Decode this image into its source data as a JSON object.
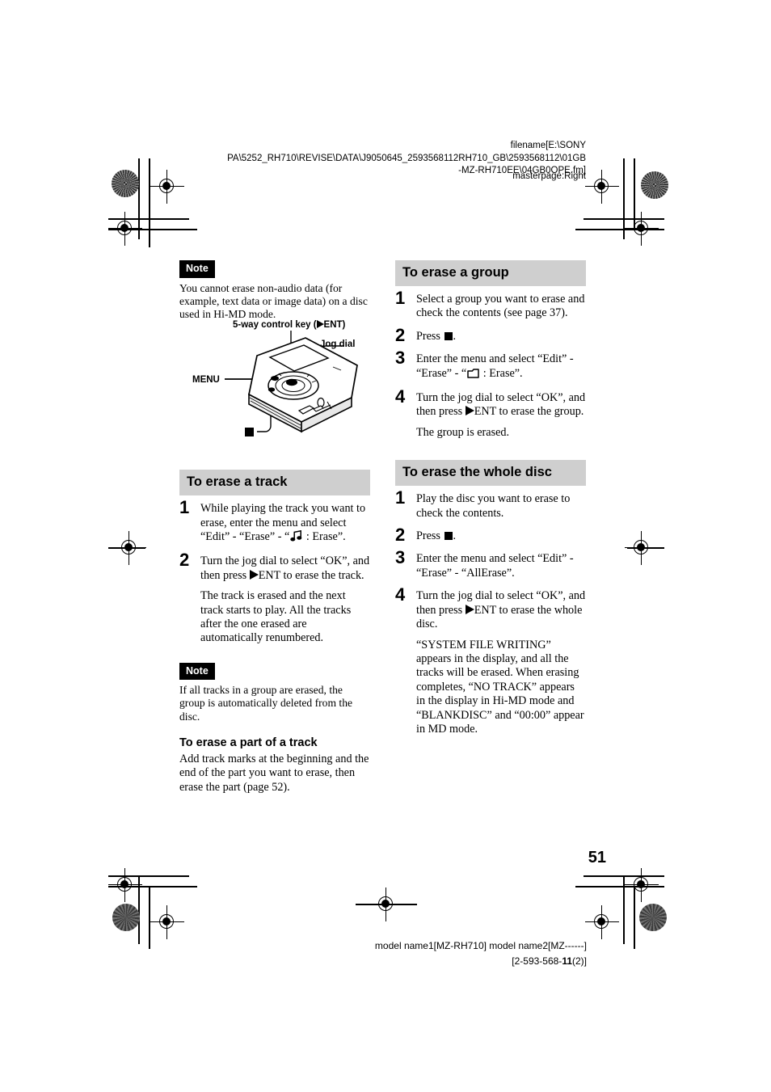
{
  "prepress": {
    "filename_line1": "filename[E:\\SONY",
    "filename_line2": "PA\\5252_RH710\\REVISE\\DATA\\J9050645_2593568112RH710_GB\\2593568112\\01GB",
    "filename_line3": "-MZ-RH710EE\\04GB0OPE.fm]",
    "masterpage": "masterpage:Right"
  },
  "left_column": {
    "note1": {
      "badge": "Note",
      "text": "You cannot erase non-audio data (for example, text data or image data) on a disc used in Hi-MD mode."
    },
    "illustration": {
      "callout_5way": "5-way control key (",
      "callout_5way_end": "ENT)",
      "callout_jog": "Jog dial",
      "callout_menu": "MENU",
      "callout_stop": ""
    },
    "section_track": {
      "heading": "To erase a track",
      "steps": [
        {
          "num": "1",
          "text_a": "While playing the track you want to erase, enter the menu and select “Edit” - “Erase” - “",
          "text_b": " : Erase”."
        },
        {
          "num": "2",
          "text_a": "Turn the jog dial to select “OK”, and then press ",
          "text_b": "ENT to erase the track.",
          "sub": "The track is erased and the next track starts to play. All the tracks after the one erased are automatically renumbered."
        }
      ]
    },
    "note2": {
      "badge": "Note",
      "text": "If all tracks in a group are erased, the group is automatically deleted from the disc."
    },
    "section_part": {
      "heading": "To erase a part of a track",
      "body": "Add track marks at the beginning and the end of the part you want to erase, then erase the part (page 52)."
    }
  },
  "right_column": {
    "section_group": {
      "heading": "To erase a group",
      "steps": [
        {
          "num": "1",
          "text_a": "Select a group you want to erase and check the contents (see page 37)."
        },
        {
          "num": "2",
          "text_a": "Press ",
          "text_b": "."
        },
        {
          "num": "3",
          "text_a": "Enter the menu and select “Edit” - “Erase” - “",
          "text_b": " : Erase”."
        },
        {
          "num": "4",
          "text_a": "Turn the jog dial to select “OK”, and then press ",
          "text_b": "ENT to erase the group.",
          "sub": "The group is erased."
        }
      ]
    },
    "section_disc": {
      "heading": "To erase the whole disc",
      "steps": [
        {
          "num": "1",
          "text_a": "Play the disc you want to erase to check the contents."
        },
        {
          "num": "2",
          "text_a": "Press ",
          "text_b": "."
        },
        {
          "num": "3",
          "text_a": "Enter the menu and select “Edit” - “Erase” - “AllErase”."
        },
        {
          "num": "4",
          "text_a": "Turn the jog dial to select “OK”, and then press ",
          "text_b": "ENT to erase the whole disc.",
          "sub": "“SYSTEM FILE WRITING” appears in the display, and all the tracks will be erased.\nWhen erasing completes, “NO TRACK” appears in the display in Hi-MD mode and “BLANKDISC” and “00:00” appear in MD mode."
        }
      ]
    }
  },
  "page_number": "51",
  "footer": {
    "model_line": "model name1[MZ-RH710] model name2[MZ------]",
    "part_prefix": "[2-593-568-",
    "part_bold": "11",
    "part_suffix": "(2)]"
  }
}
